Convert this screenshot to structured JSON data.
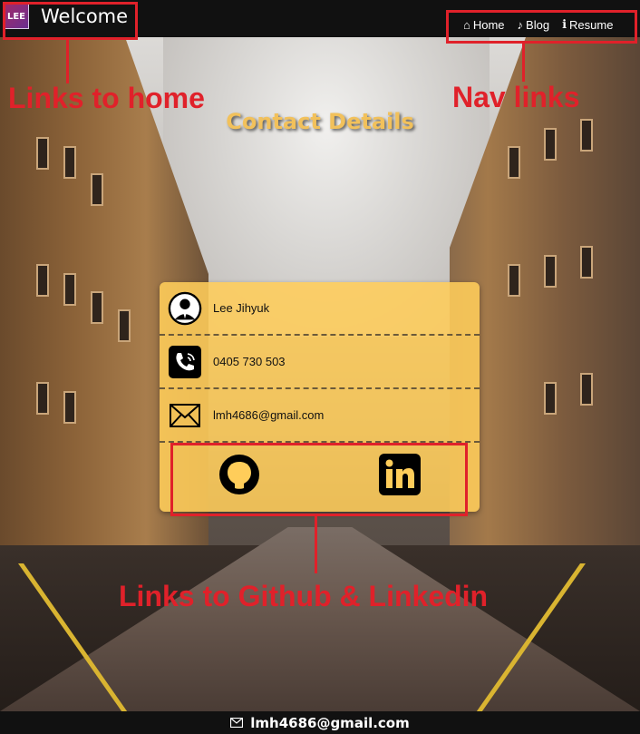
{
  "header": {
    "logo_text": "LEE",
    "title": "Welcome",
    "nav": [
      {
        "icon": "home-icon",
        "glyph": "⌂",
        "label": "Home"
      },
      {
        "icon": "music-note-icon",
        "glyph": "♪",
        "label": "Blog"
      },
      {
        "icon": "info-icon",
        "glyph": "ℹ",
        "label": "Resume"
      }
    ]
  },
  "annotations": {
    "home": "Links to home",
    "nav": "Nav links",
    "social": "Links to Github & Linkedin"
  },
  "heading": "Contact Details",
  "contact": {
    "name": "Lee Jihyuk",
    "phone": "0405 730 503",
    "email": "lmh4686@gmail.com"
  },
  "social": {
    "github_icon": "github-icon",
    "linkedin_icon": "linkedin-icon"
  },
  "footer": {
    "email": "lmh4686@gmail.com",
    "icon": "mail-icon"
  },
  "colors": {
    "annotation": "#e0212a",
    "card": "#ffcd5a",
    "heading": "#f2c15b",
    "bar": "#111111"
  }
}
